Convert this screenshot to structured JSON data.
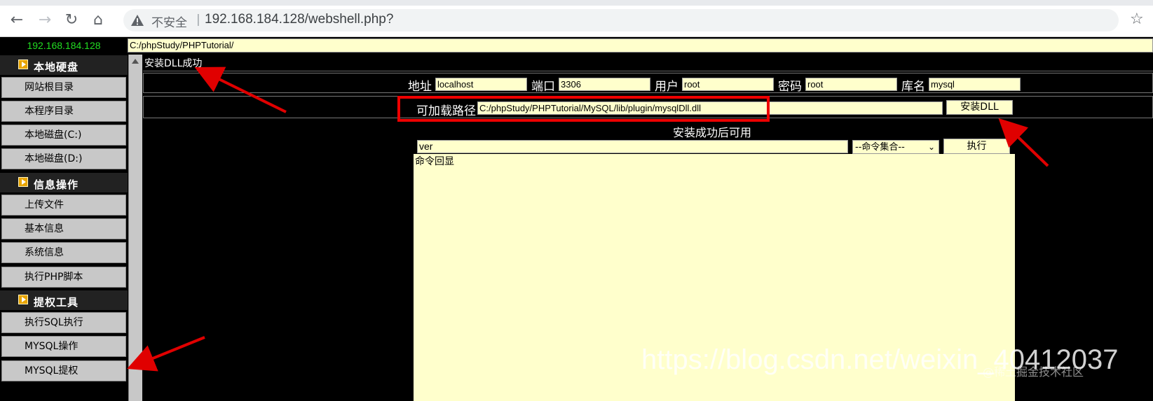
{
  "browser": {
    "security_label": "不安全",
    "url": "192.168.184.128/webshell.php?"
  },
  "shell": {
    "server_ip": "192.168.184.128",
    "current_path": "C:/phpStudy/PHPTutorial/"
  },
  "sidebar": {
    "sections": [
      {
        "title": "本地硬盘",
        "items": [
          "网站根目录",
          "本程序目录",
          "本地磁盘(C:)",
          "本地磁盘(D:)"
        ]
      },
      {
        "title": "信息操作",
        "items": [
          "上传文件",
          "基本信息",
          "系统信息",
          "执行PHP脚本"
        ]
      },
      {
        "title": "提权工具",
        "items": [
          "执行SQL执行",
          "MYSQL操作",
          "MYSQL提权"
        ]
      }
    ]
  },
  "main": {
    "status_message": "安装DLL成功",
    "connection": {
      "host_label": "地址",
      "host_value": "localhost",
      "port_label": "端口",
      "port_value": "3306",
      "user_label": "用户",
      "user_value": "root",
      "password_label": "密码",
      "password_value": "root",
      "db_label": "库名",
      "db_value": "mysql"
    },
    "dll": {
      "path_label": "可加载路径",
      "path_value": "C:/phpStudy/PHPTutorial/MySQL/lib/plugin/mysqlDll.dll",
      "install_button": "安装DLL"
    },
    "command": {
      "hint": "安装成功后可用",
      "input_value": "ver",
      "select_value": "--命令集合--",
      "execute_button": "执行",
      "output_text": "命令回显"
    }
  },
  "overlay": {
    "watermark": "https://blog.csdn.net/weixin_40412037",
    "watermark_small": "@稀土掘金技术社区",
    "annotation_color": "#e00000"
  }
}
